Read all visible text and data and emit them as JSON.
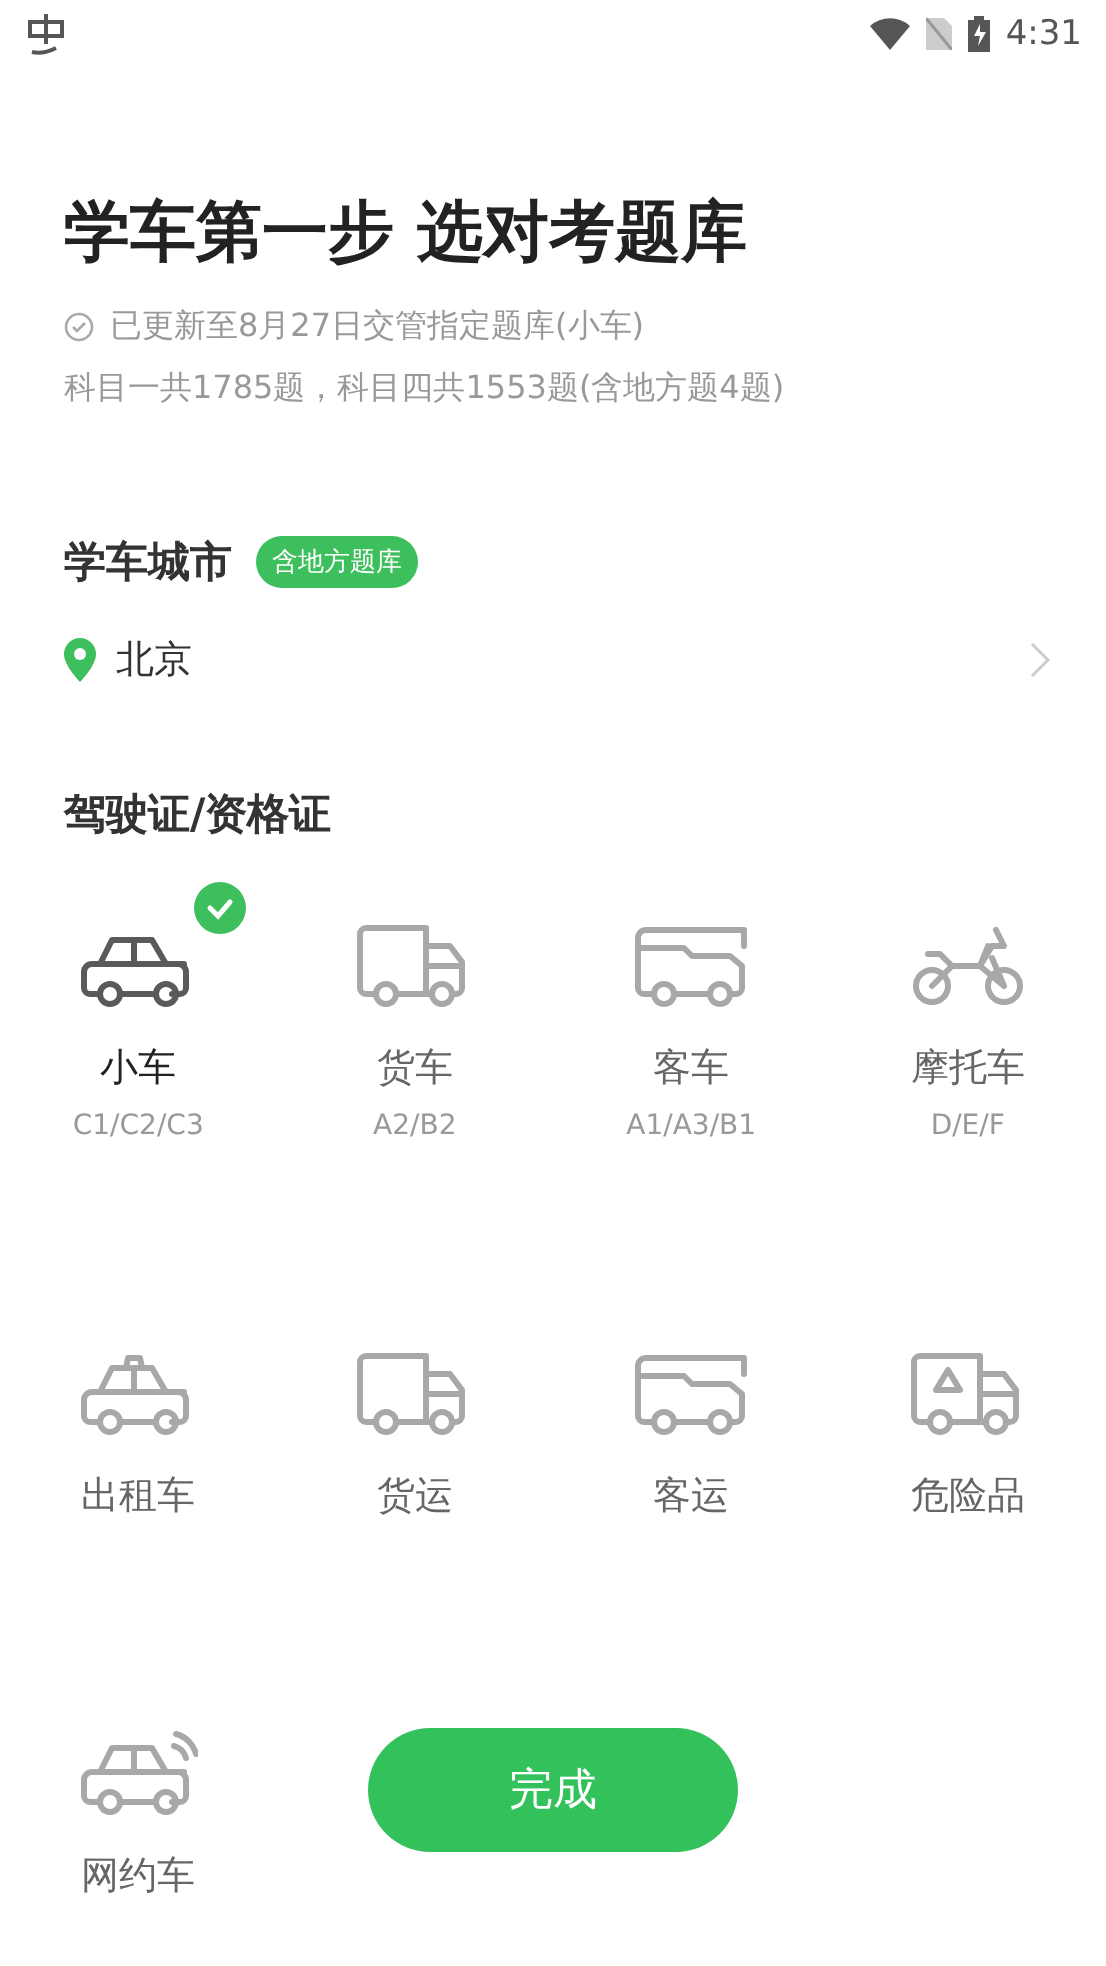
{
  "status_bar": {
    "time": "4:31"
  },
  "header": {
    "title": "学车第一步 选对考题库",
    "update_note": "已更新至8月27日交管指定题库(小车)",
    "question_counts": "科目一共1785题，科目四共1553题(含地方题4题)"
  },
  "city_section": {
    "title": "学车城市",
    "badge": "含地方题库",
    "city": "北京"
  },
  "license_section": {
    "title": "驾驶证/资格证",
    "items": [
      {
        "kind": "car",
        "label": "小车",
        "code": "C1/C2/C3",
        "selected": true
      },
      {
        "kind": "truck",
        "label": "货车",
        "code": "A2/B2",
        "selected": false
      },
      {
        "kind": "bus",
        "label": "客车",
        "code": "A1/A3/B1",
        "selected": false
      },
      {
        "kind": "motorcycle",
        "label": "摩托车",
        "code": "D/E/F",
        "selected": false
      },
      {
        "kind": "taxi",
        "label": "出租车",
        "selected": false
      },
      {
        "kind": "truck",
        "label": "货运",
        "selected": false
      },
      {
        "kind": "bus",
        "label": "客运",
        "selected": false
      },
      {
        "kind": "hazmat",
        "label": "危险品",
        "selected": false
      },
      {
        "kind": "ridehail",
        "label": "网约车",
        "selected": false
      }
    ]
  },
  "done_button": {
    "label": "完成"
  }
}
